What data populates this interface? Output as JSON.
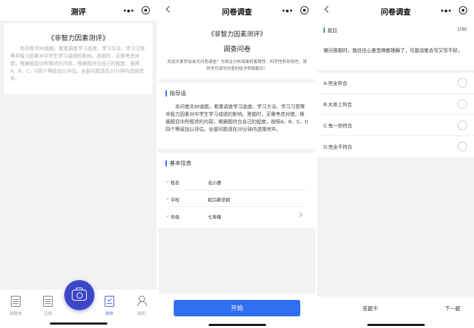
{
  "screen1": {
    "title": "测评",
    "card_title": "《非智力因素测评》",
    "card_text": "本问卷共99道题，看重调查学习态度、学习方法、学习习惯等非智力因素对中学生学习成绩的影响。答题时，无需考虑对错，根据题目中所叙述的内容，根据题符合自己的程度，按照A、B、C、D四个等级加以评估。全部问题请在20分钟内选择完毕。",
    "tabs": [
      {
        "label": "错题本",
        "icon": "notebook-icon"
      },
      {
        "label": "文档",
        "icon": "document-icon"
      },
      {
        "label": "测评",
        "icon": "evaluation-icon",
        "active": true
      },
      {
        "label": "我的",
        "icon": "person-icon"
      }
    ]
  },
  "screen2": {
    "title": "问卷调查",
    "survey_title": "《非智力因素测评》",
    "survey_subtitle": "调查问卷",
    "welcome": "欢迎大家参加本次问卷调查！为保证分析结果的客观性、科学性和有效性，请同学在填写问卷时给予积极配合！",
    "guide_heading": "指导语",
    "guide_text": "本问卷共99道题，看重调查学习态度、学习方法、学习习惯等非智力因素对中学生学习成绩的影响。答题时，无需考虑对错，根据题目中所叙述的内容，根据题符合自己的程度，按照A、B、C、D四个等级加以评估。全部问题请在20分钟内选择完毕。",
    "info_heading": "基本信息",
    "fields": [
      {
        "label": "姓名",
        "value": "北小辰"
      },
      {
        "label": "学校",
        "value": "虹口新华初"
      },
      {
        "label": "年级",
        "value": "七年级"
      }
    ],
    "start_label": "开始"
  },
  "screen3": {
    "title": "问卷调查",
    "question_heading": "题目",
    "question_count": "1/99",
    "question_text": "做问答题时，我往往心里觉得都理解了，可是动笔去写又写不好。",
    "options": [
      "A.完全符合",
      "B.大体上符合",
      "C.有一些符合",
      "D.完全不符合"
    ],
    "answer_card_label": "答题卡",
    "next_label": "下一题"
  }
}
